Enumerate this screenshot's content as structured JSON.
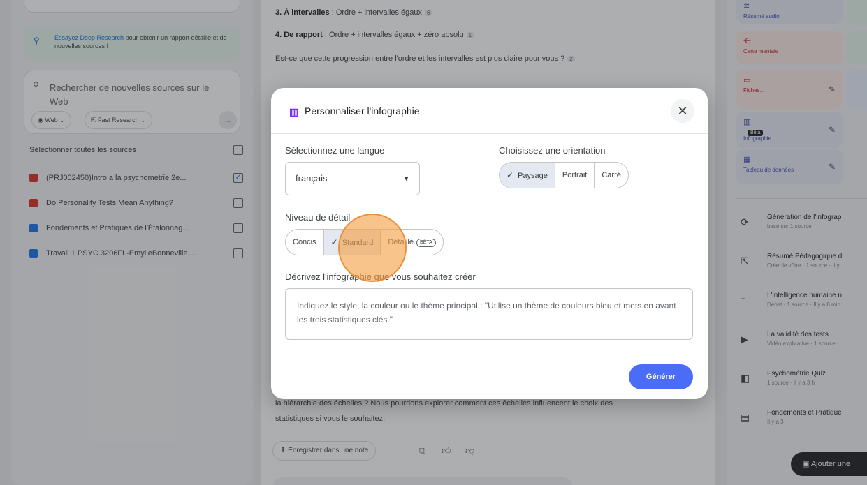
{
  "left_panel": {
    "deep_research": {
      "link": "Essayez Deep Research",
      "text": " pour obtenir un rapport détaillé et de nouvelles sources !"
    },
    "search_placeholder": "Rechercher de nouvelles sources sur le Web",
    "web_chip": "Web",
    "fast_chip": "Fast Research",
    "select_all": "Sélectionner toutes les sources",
    "sources": [
      {
        "title": "(PRJ002450)Intro a la psychometrie 2e...",
        "color": "#d93025",
        "checked": "✓"
      },
      {
        "title": "Do Personality Tests Mean Anything?",
        "color": "#d93025",
        "checked": ""
      },
      {
        "title": "Fondements et Pratiques de l'Étalonnag...",
        "color": "#1a73e8",
        "checked": ""
      },
      {
        "title": "Travail 1 PSYC 3206FL-EmylieBonneville....",
        "color": "#1a73e8",
        "checked": ""
      }
    ]
  },
  "center_panel": {
    "line1": {
      "bold": "3. À intervalles",
      "text": " : Ordre + intervalles égaux",
      "cite": "6"
    },
    "line2": {
      "bold": "4. De rapport",
      "text": " : Ordre + intervalles égaux + zéro absolu",
      "cite": "1"
    },
    "line3": {
      "text": "Est-ce que cette progression entre l'ordre et les intervalles est plus claire pour vous ?",
      "cite": "2"
    },
    "line4": "la hiérarchie des échelles ? Nous pourrions explorer comment ces échelles influencent le choix des",
    "line5": "statistiques si vous le souhaitez.",
    "save_note": "Enregistrer dans une note"
  },
  "right_panel": {
    "tiles": [
      {
        "title": "Résumé audio",
        "icon": "≋"
      },
      {
        "title": "Carte mentale",
        "icon": "⋲"
      },
      {
        "title": "Fiches...",
        "icon": "▭"
      },
      {
        "title": "Infographie",
        "icon": "▥",
        "badge": "Bêta"
      },
      {
        "title": "Tableau de données",
        "icon": "▦"
      }
    ],
    "artifacts": [
      {
        "title": "Génération de l'infograp",
        "sub": "basé sur 1 source",
        "icon": "⟳"
      },
      {
        "title": "Résumé Pédagogique d",
        "sub": "Créer le vôtre · 1 source · Il y",
        "icon": "⇱"
      },
      {
        "title": "L'intelligence humaine n",
        "sub": "Débat · 1 source · Il y a 8 min",
        "icon": "⁺"
      },
      {
        "title": "La validité des tests",
        "sub": "Vidéo explicative · 1 source ·",
        "icon": "▶"
      },
      {
        "title": "Psychométrie Quiz",
        "sub": "1 source · Il y a 3 h",
        "icon": "◧"
      },
      {
        "title": "Fondements et Pratique",
        "sub": "Il y a 3",
        "icon": "▤"
      }
    ],
    "add_note": "Ajouter une"
  },
  "modal": {
    "title": "Personnaliser l'infographie",
    "language_label": "Sélectionnez une langue",
    "language_value": "français",
    "orientation_label": "Choisissez une orientation",
    "orientations": [
      {
        "label": "Paysage",
        "selected": true
      },
      {
        "label": "Portrait",
        "selected": false
      },
      {
        "label": "Carré",
        "selected": false
      }
    ],
    "detail_label": "Niveau de détail",
    "details": [
      {
        "label": "Concis",
        "selected": false
      },
      {
        "label": "Standard",
        "selected": true
      },
      {
        "label": "Détaillé",
        "selected": false,
        "badge": "BÊTA"
      }
    ],
    "describe_label": "Décrivez l'infographie que vous souhaitez créer",
    "describe_placeholder": "Indiquez le style, la couleur ou le thème principal : \"Utilise un thème de couleurs bleu et mets en avant les trois statistiques clés.\"",
    "generate_label": "Générer"
  },
  "colors": {
    "accent": "#4a6cf7",
    "pointer": "#f6a046"
  }
}
